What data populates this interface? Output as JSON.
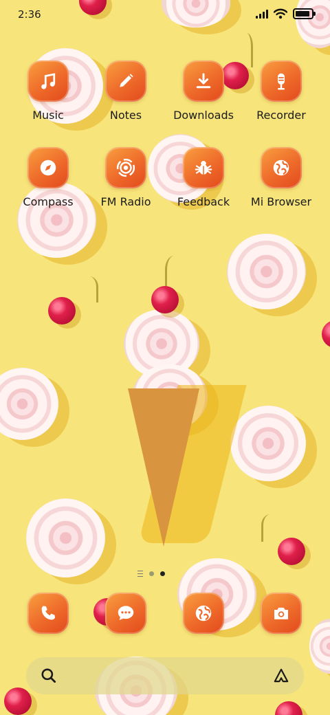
{
  "status_bar": {
    "time": "2:36",
    "signal_icon": "signal-icon",
    "wifi_icon": "wifi-icon",
    "battery_icon": "battery-icon",
    "battery_level": 0.9
  },
  "apps": [
    {
      "label": "Music",
      "icon": "music-note-icon"
    },
    {
      "label": "Notes",
      "icon": "pencil-icon"
    },
    {
      "label": "Downloads",
      "icon": "download-icon"
    },
    {
      "label": "Recorder",
      "icon": "microphone-icon"
    },
    {
      "label": "Compass",
      "icon": "compass-icon"
    },
    {
      "label": "FM Radio",
      "icon": "radio-icon"
    },
    {
      "label": "Feedback",
      "icon": "bug-icon"
    },
    {
      "label": "Mi Browser",
      "icon": "globe-icon"
    }
  ],
  "page_indicator": {
    "pages": 2,
    "current": 2
  },
  "dock": [
    {
      "icon": "phone-icon"
    },
    {
      "icon": "message-icon"
    },
    {
      "icon": "globe-icon"
    },
    {
      "icon": "camera-icon"
    }
  ],
  "search_bar": {
    "search_icon": "search-icon",
    "assistant_icon": "assistant-icon"
  },
  "colors": {
    "wallpaper": "#f7e47a",
    "icon_gradient_start": "#f9a040",
    "icon_gradient_end": "#e2491c"
  }
}
